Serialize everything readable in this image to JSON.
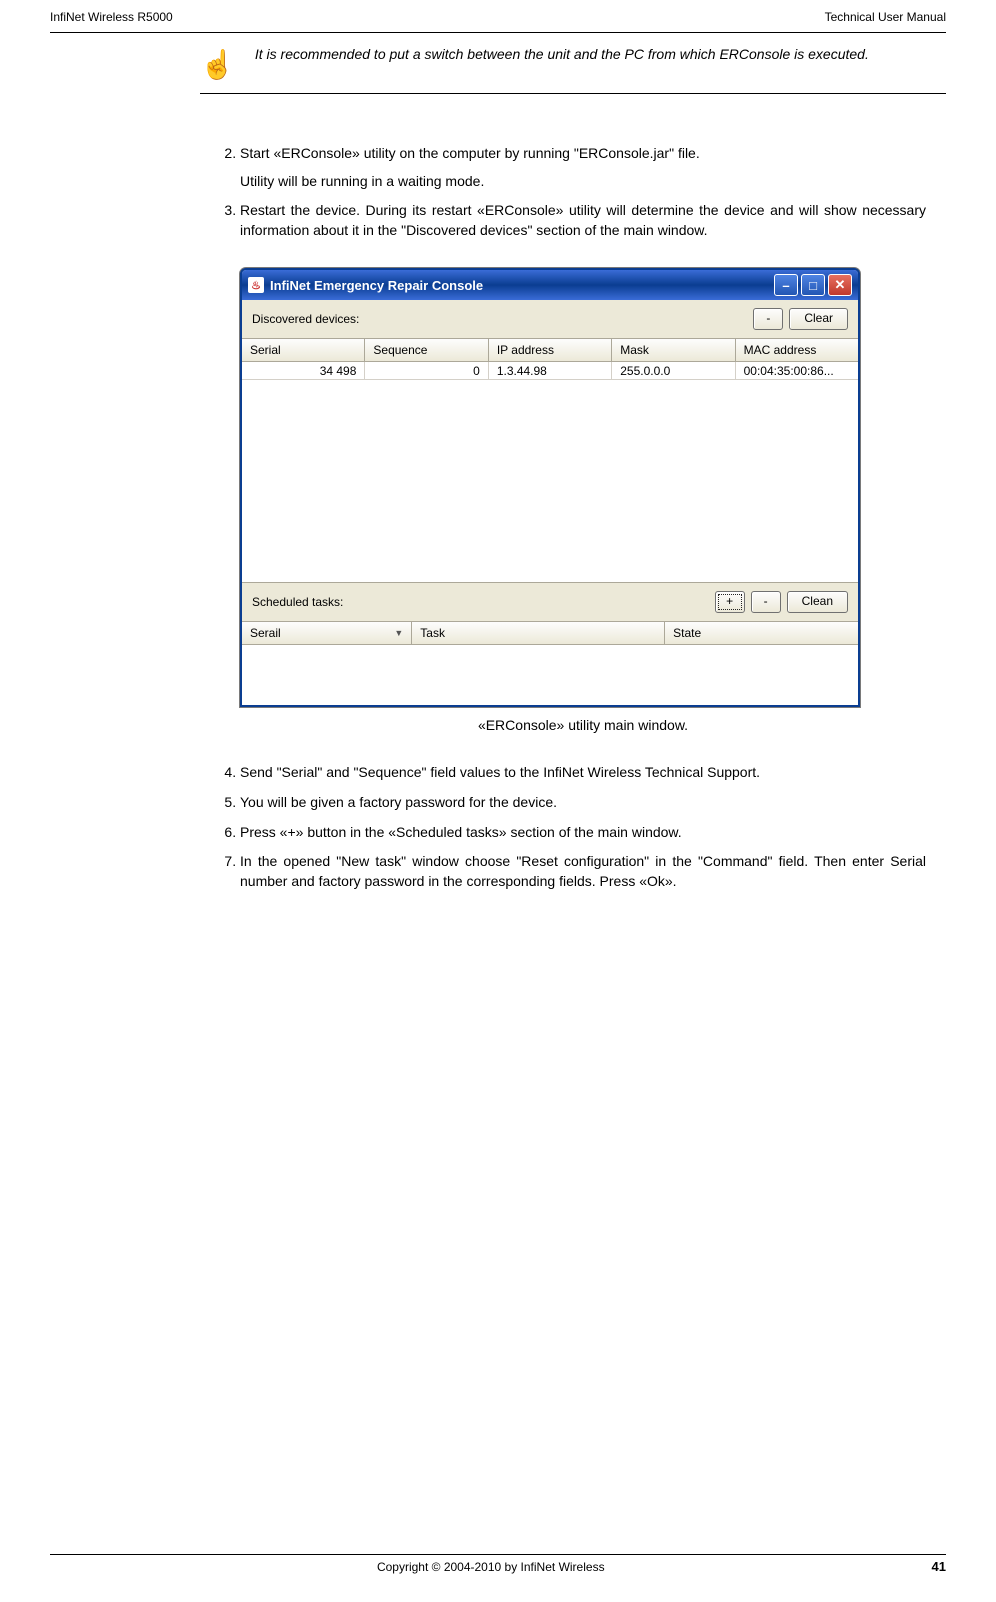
{
  "header": {
    "left": "InfiNet Wireless R5000",
    "right": "Technical User Manual"
  },
  "note": {
    "text": "It is recommended to put a switch between the unit and the PC from which ERConsole is executed."
  },
  "steps": {
    "s2": "Start «ERConsole» utility on the computer by running \"ERConsole.jar\" file.",
    "s2b": "Utility will be running in a waiting mode.",
    "s3": "Restart the device. During its restart «ERConsole» utility will determine the device and will show necessary information about it in the \"Discovered devices\" section of the main window.",
    "s4": "Send \"Serial\" and \"Sequence\" field values to the InfiNet Wireless Technical Support.",
    "s5": "You will be given a factory password for the device.",
    "s6": "Press «+» button in the «Scheduled tasks» section of the main window.",
    "s7": "In the opened \"New task\" window choose \"Reset configuration\" in the \"Command\" field. Then enter Serial number and factory password in the corresponding fields. Press «Ok»."
  },
  "screenshot": {
    "title": "InfiNet Emergency Repair Console",
    "java_glyph": "♨",
    "discovered_label": "Discovered devices:",
    "btn_minus": "-",
    "btn_clear": "Clear",
    "cols1": {
      "serial": "Serial",
      "sequence": "Sequence",
      "ip": "IP address",
      "mask": "Mask",
      "mac": "MAC address"
    },
    "row1": {
      "serial": "34 498",
      "sequence": "0",
      "ip": "1.3.44.98",
      "mask": "255.0.0.0",
      "mac": "00:04:35:00:86..."
    },
    "scheduled_label": "Scheduled tasks:",
    "btn_plus": "+",
    "btn_minus2": "-",
    "btn_clean": "Clean",
    "cols2": {
      "serial": "Serail",
      "task": "Task",
      "state": "State"
    }
  },
  "caption": "«ERConsole» utility main window.",
  "footer": {
    "copyright": "Copyright © 2004-2010 by InfiNet Wireless",
    "page": "41"
  }
}
